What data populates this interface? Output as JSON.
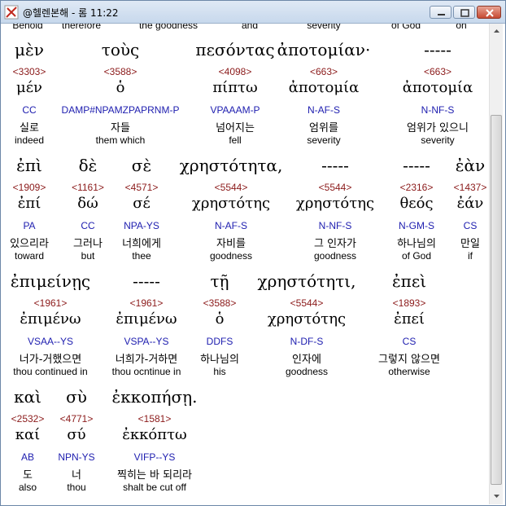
{
  "window": {
    "title": "@헬렌본해 - 롬 11:22"
  },
  "top_partial": [
    "Behold",
    "therefore",
    "the goodness",
    "and",
    "severity",
    "of God",
    "on"
  ],
  "blocks": [
    {
      "words": [
        {
          "greek": "μὲν",
          "strong": "<3303>",
          "lemma": "μέν",
          "morph": "CC",
          "korean": "실로",
          "english": "indeed"
        },
        {
          "greek": "τοὺς",
          "strong": "<3588>",
          "lemma": "ὁ",
          "morph": "DAMP#NPAMZPAPRNM-P",
          "korean": "자들",
          "english": "them which"
        },
        {
          "greek": "πεσόντας",
          "strong": "<4098>",
          "lemma": "πίπτω",
          "morph": "VPAAAM-P",
          "korean": "넘어지는",
          "english": "fell"
        },
        {
          "greek": "ἀποτομίαν·",
          "strong": "<663>",
          "lemma": "ἀποτομία",
          "morph": "N-AF-S",
          "korean": "엄위를",
          "english": "severity"
        },
        {
          "greek": "-----",
          "strong": "<663>",
          "lemma": "ἀποτομία",
          "morph": "N-NF-S",
          "korean": "엄위가 있으니",
          "english": "severity"
        }
      ]
    },
    {
      "words": [
        {
          "greek": "ἐπὶ",
          "strong": "<1909>",
          "lemma": "ἐπί",
          "morph": "PA",
          "korean": "있으리라",
          "english": "toward"
        },
        {
          "greek": "δὲ",
          "strong": "<1161>",
          "lemma": "δώ",
          "morph": "CC",
          "korean": "그러나",
          "english": "but"
        },
        {
          "greek": "σὲ",
          "strong": "<4571>",
          "lemma": "σέ",
          "morph": "NPA-YS",
          "korean": "너희에게",
          "english": "thee"
        },
        {
          "greek": "χρηστότητα,",
          "strong": "<5544>",
          "lemma": "χρηστότης",
          "morph": "N-AF-S",
          "korean": "자비를",
          "english": "goodness"
        },
        {
          "greek": "-----",
          "strong": "<5544>",
          "lemma": "χρηστότης",
          "morph": "N-NF-S",
          "korean": "그 인자가",
          "english": "goodness"
        },
        {
          "greek": "-----",
          "strong": "<2316>",
          "lemma": "θεός",
          "morph": "N-GM-S",
          "korean": "하나님의",
          "english": "of God"
        },
        {
          "greek": "ἐὰν",
          "strong": "<1437>",
          "lemma": "ἐάν",
          "morph": "CS",
          "korean": "만일",
          "english": "if"
        }
      ]
    },
    {
      "words": [
        {
          "greek": "ἐπιμείνῃς",
          "strong": "<1961>",
          "lemma": "ἐπιμένω",
          "morph": "VSAA--YS",
          "korean": "너가-거했으면",
          "english": "thou continued in"
        },
        {
          "greek": "-----",
          "strong": "<1961>",
          "lemma": "ἐπιμένω",
          "morph": "VSPA--YS",
          "korean": "너희가-거하면",
          "english": "thou ocntinue in"
        },
        {
          "greek": "τῇ",
          "strong": "<3588>",
          "lemma": "ὁ",
          "morph": "DDFS",
          "korean": "하나님의",
          "english": "his"
        },
        {
          "greek": "χρηστότητι,",
          "strong": "<5544>",
          "lemma": "χρηστότης",
          "morph": "N-DF-S",
          "korean": "인자에",
          "english": "goodness"
        },
        {
          "greek": "ἐπεὶ",
          "strong": "<1893>",
          "lemma": "ἐπεί",
          "morph": "CS",
          "korean": "그렇지 않으면",
          "english": "otherwise"
        }
      ]
    },
    {
      "words": [
        {
          "greek": "καὶ",
          "strong": "<2532>",
          "lemma": "καί",
          "morph": "AB",
          "korean": "도",
          "english": "also"
        },
        {
          "greek": "σὺ",
          "strong": "<4771>",
          "lemma": "σύ",
          "morph": "NPN-YS",
          "korean": "너",
          "english": "thou"
        },
        {
          "greek": "ἐκκοπήσῃ.",
          "strong": "<1581>",
          "lemma": "ἐκκόπτω",
          "morph": "VIFP--YS",
          "korean": "찍히는 바 되리라",
          "english": "shalt be cut off"
        }
      ]
    }
  ],
  "colors": {
    "strong": "#8b1a1a",
    "morph": "#2020b0",
    "titlebar": "#c7d8ec"
  },
  "icons": [
    "app-icon",
    "minimize-icon",
    "maximize-icon",
    "close-icon",
    "scroll-up-icon",
    "scroll-down-icon"
  ]
}
